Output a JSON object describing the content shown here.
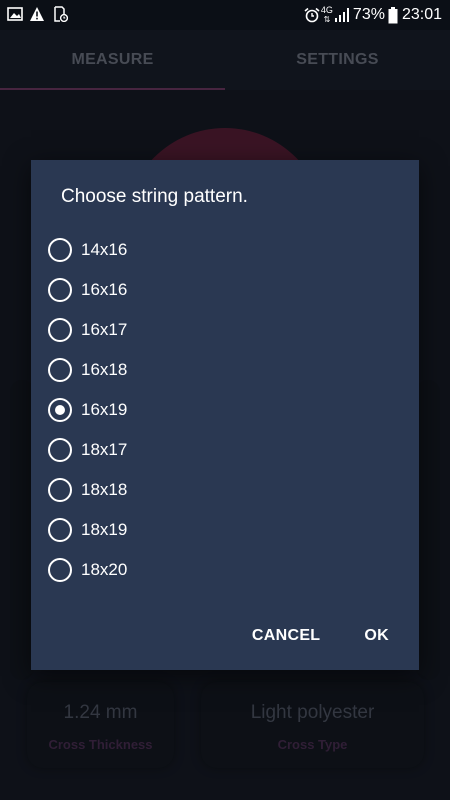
{
  "status_bar": {
    "network": "4G",
    "battery_percent": "73%",
    "time": "23:01"
  },
  "tabs": [
    {
      "label": "MEASURE",
      "selected": true
    },
    {
      "label": "SETTINGS",
      "selected": false
    }
  ],
  "background": {
    "cards": [
      {
        "value": "1.24 mm",
        "label": "Cross Thickness"
      },
      {
        "value": "Light polyester",
        "label": "Cross Type"
      }
    ]
  },
  "dialog": {
    "title": "Choose string pattern.",
    "options": [
      "14x16",
      "16x16",
      "16x17",
      "16x18",
      "16x19",
      "18x17",
      "18x18",
      "18x19",
      "18x20"
    ],
    "selected": "16x19",
    "cancel_label": "CANCEL",
    "ok_label": "OK"
  },
  "colors": {
    "dialog_bg": "#2a3852",
    "app_bg": "#161b26",
    "accent": "#6d3a63"
  }
}
